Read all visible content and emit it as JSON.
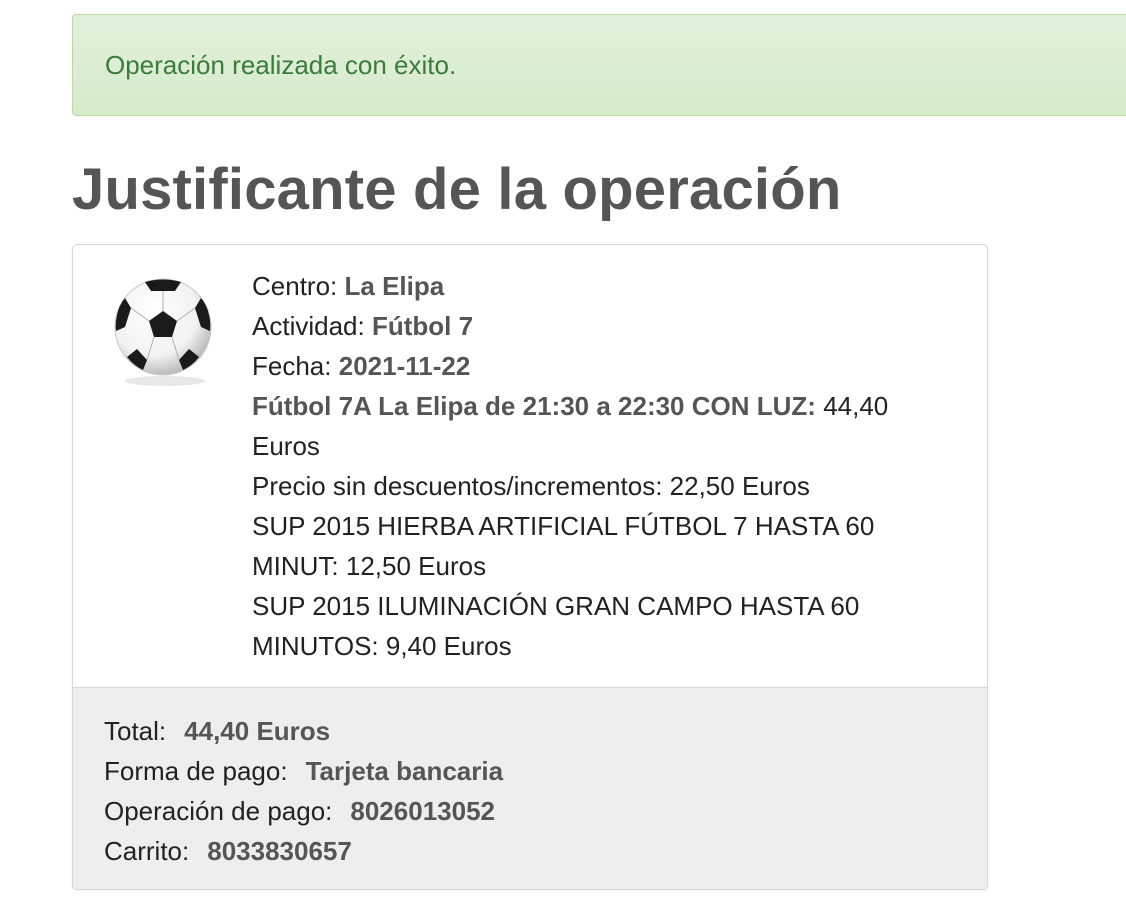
{
  "alert": {
    "message": "Operación realizada con éxito."
  },
  "page": {
    "title": "Justificante de la operación"
  },
  "receipt": {
    "icon": "soccer-ball-icon",
    "centro_label": "Centro:",
    "centro_value": "La Elipa",
    "actividad_label": "Actividad:",
    "actividad_value": "Fútbol 7",
    "fecha_label": "Fecha:",
    "fecha_value": "2021-11-22",
    "slot_label": "Fútbol 7A La Elipa de 21:30 a 22:30 CON LUZ:",
    "slot_value": "44,40 Euros",
    "precio_text": "Precio sin descuentos/incrementos: 22,50 Euros",
    "sup1_text": "SUP 2015 HIERBA ARTIFICIAL FÚTBOL 7 HASTA 60 MINUT: 12,50 Euros",
    "sup2_text": "SUP 2015 ILUMINACIÓN GRAN CAMPO HASTA 60 MINUTOS: 9,40 Euros"
  },
  "summary": {
    "total_label": "Total:",
    "total_value": "44,40 Euros",
    "pago_label": "Forma de pago:",
    "pago_value": "Tarjeta bancaria",
    "operacion_label": "Operación de pago:",
    "operacion_value": "8026013052",
    "carrito_label": "Carrito:",
    "carrito_value": "8033830657"
  }
}
